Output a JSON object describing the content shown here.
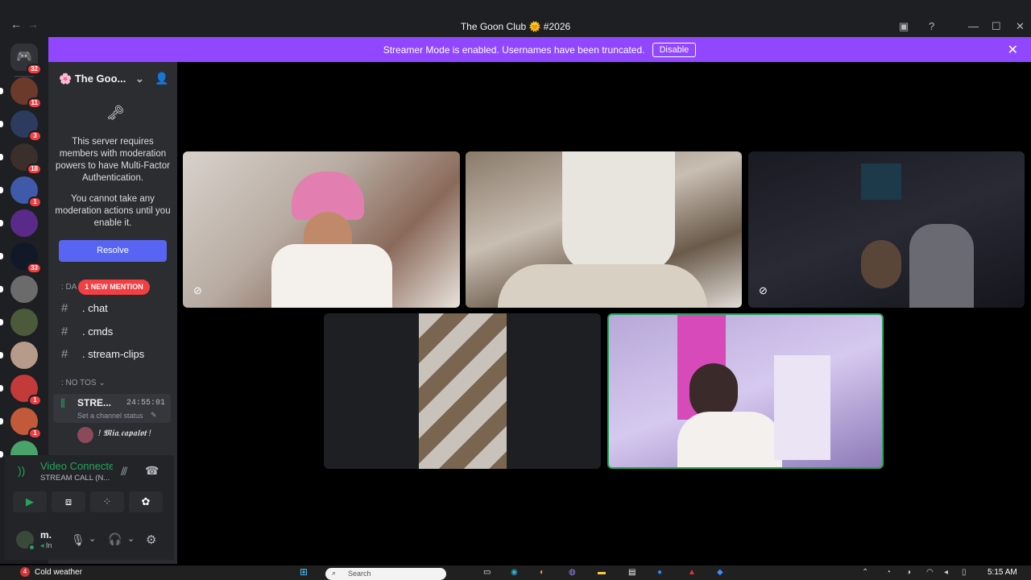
{
  "window": {
    "title": "The Goon Club 🌞 #2026",
    "back": "←",
    "forward": "→"
  },
  "banner": {
    "text": "Streamer Mode is enabled. Usernames have been truncated.",
    "button": "Disable"
  },
  "rail": {
    "home_badge": "32",
    "servers": [
      {
        "badge": "11",
        "color": "#6b3a2a"
      },
      {
        "badge": "3",
        "color": "#2c3b5e"
      },
      {
        "badge": "18",
        "color": "#3a2f2a"
      },
      {
        "badge": "1",
        "color": "#3f5aa8"
      },
      {
        "badge": "",
        "color": "#5a2a8a"
      },
      {
        "badge": "33",
        "color": "#111827"
      },
      {
        "badge": "",
        "color": "#6b6b6b"
      },
      {
        "badge": "",
        "color": "#4a5a3a"
      },
      {
        "badge": "",
        "color": "#b69a8a"
      },
      {
        "badge": "1",
        "color": "#c23a3a"
      },
      {
        "badge": "1",
        "color": "#c25a3a"
      },
      {
        "badge": "",
        "color": "#4aa36a"
      }
    ]
  },
  "server": {
    "name": "The Goo...",
    "server_icon": "🌸"
  },
  "mfa": {
    "icon": "🗝",
    "line1": "This server requires members with moderation powers to have Multi-Factor Authentication.",
    "line2": "You cannot take any moderation actions until you enable it.",
    "resolve": "Resolve"
  },
  "categories": {
    "first": ": DA",
    "mention": "1 NEW MENTION",
    "second": ": NO TOS"
  },
  "channels": [
    ". chat",
    ". cmds",
    ". stream-clips"
  ],
  "voice_channel": {
    "name": "STRE...",
    "timer": "24:55:01",
    "status": "Set a channel status",
    "user": "! 𝕸𝖎𝖆.𝖈𝖆𝖕𝖆𝖑𝖔𝖙 !"
  },
  "connection": {
    "title": "Video Connected",
    "subtitle": "STREAM CALL (N..."
  },
  "user": {
    "name": "m.",
    "status": "In"
  },
  "colors": {
    "accent": "#9147ff",
    "blurple": "#5865f2",
    "green": "#23a55a",
    "red": "#f23f43"
  },
  "taskbar": {
    "weather_badge": "4",
    "weather": "Cold weather",
    "search": "Search",
    "time": "5:15 AM"
  }
}
